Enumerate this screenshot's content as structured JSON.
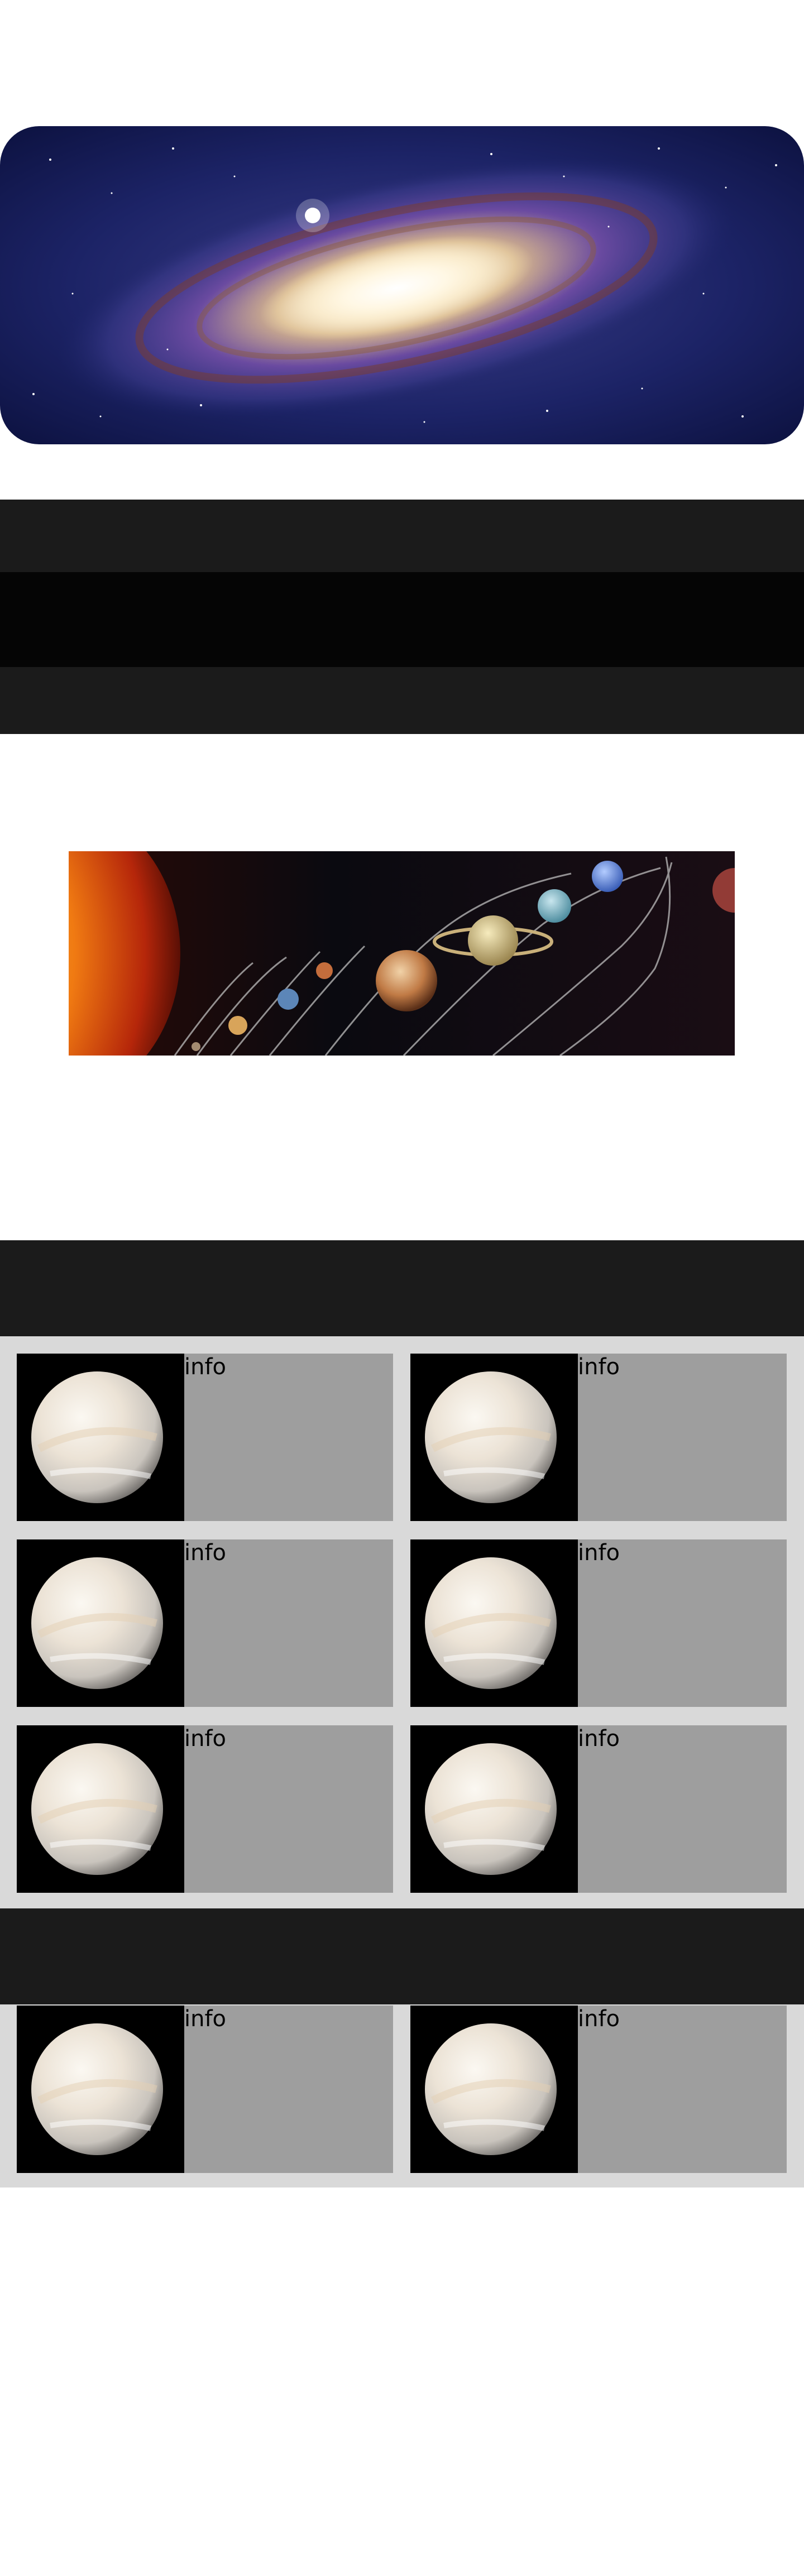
{
  "hero": {
    "icon": "galaxy-image"
  },
  "banner": {
    "icon": "solar-system-image"
  },
  "cards": [
    {
      "thumb_icon": "venus-image",
      "label": "info"
    },
    {
      "thumb_icon": "venus-image",
      "label": "info"
    },
    {
      "thumb_icon": "venus-image",
      "label": "info"
    },
    {
      "thumb_icon": "venus-image",
      "label": "info"
    },
    {
      "thumb_icon": "venus-image",
      "label": "info"
    },
    {
      "thumb_icon": "venus-image",
      "label": "info"
    },
    {
      "thumb_icon": "venus-image",
      "label": "info"
    },
    {
      "thumb_icon": "venus-image",
      "label": "info"
    }
  ],
  "colors": {
    "page_background": "#ffffff",
    "dark_bar": "#1b1b1b",
    "band_middle": "#050505",
    "grid_background": "#d9d9d9",
    "card_background": "#9e9e9e"
  }
}
